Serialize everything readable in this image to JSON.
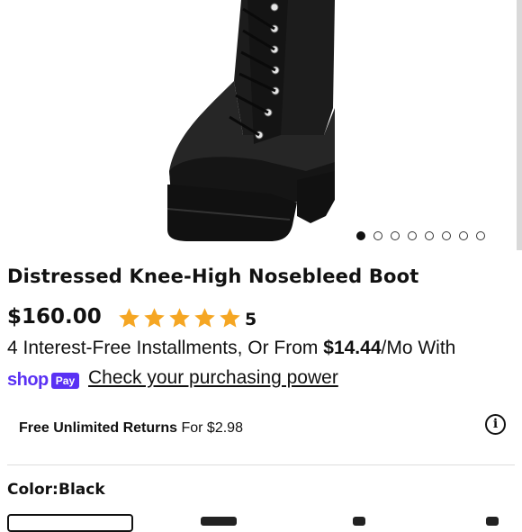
{
  "product": {
    "title": "Distressed Knee-High Nosebleed Boot",
    "price": "$160.00",
    "rating": 5,
    "rating_label": "5",
    "image_icon": "boot-product-image",
    "carousel": {
      "total": 8,
      "active": 1
    }
  },
  "installments": {
    "prefix": "4 Interest-Free Installments, Or From ",
    "amount": "$14.44",
    "suffix": "/Mo With"
  },
  "shop_pay": {
    "shop": "shop",
    "pay": "Pay",
    "link": "Check your purchasing power",
    "brand_color": "#5a31f4"
  },
  "returns": {
    "bold": "Free Unlimited Returns",
    "rest": " For $2.98",
    "info_icon": "info-icon"
  },
  "color": {
    "label": "Color:",
    "value": "Black"
  },
  "colors": {
    "star": "#f5a623",
    "text": "#111111"
  }
}
